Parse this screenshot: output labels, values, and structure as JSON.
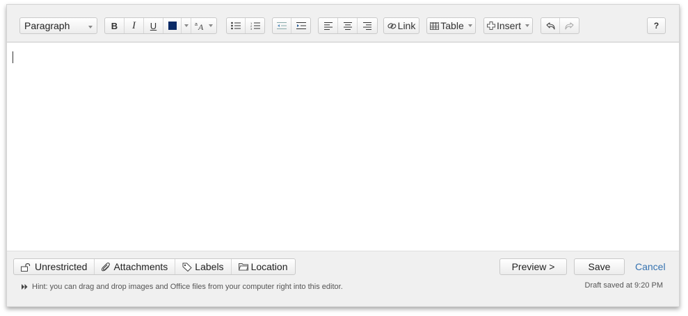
{
  "toolbar": {
    "paragraph_select": "Paragraph",
    "bold": "B",
    "italic": "I",
    "underline": "U",
    "link_label": "Link",
    "table_label": "Table",
    "insert_label": "Insert",
    "help": "?"
  },
  "colors": {
    "text_color_swatch": "#0a2a66",
    "cancel_link": "#3572b0"
  },
  "footer": {
    "restrictions": "Unrestricted",
    "attachments": "Attachments",
    "labels": "Labels",
    "location": "Location",
    "preview": "Preview >",
    "save": "Save",
    "cancel": "Cancel",
    "hint": "Hint: you can drag and drop images and Office files from your computer right into this editor.",
    "draft_status": "Draft saved at 9:20 PM"
  }
}
